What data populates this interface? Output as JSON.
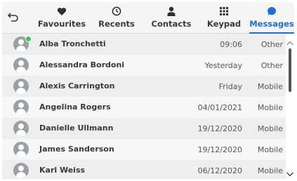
{
  "tabs": [
    {
      "label": "Favourites",
      "icon": "heart-icon"
    },
    {
      "label": "Recents",
      "icon": "clock-icon"
    },
    {
      "label": "Contacts",
      "icon": "person-icon"
    },
    {
      "label": "Keypad",
      "icon": "keypad-icon"
    },
    {
      "label": "Messages",
      "icon": "message-bubble-icon"
    }
  ],
  "active_tab": "Messages",
  "colors": {
    "accent": "#1e6fd1",
    "online": "#3cc05a"
  },
  "conversations": [
    {
      "name": "Alba Tronchetti",
      "date": "09:06",
      "type": "Other",
      "online": true
    },
    {
      "name": "Alessandra Bordoni",
      "date": "Yesterday",
      "type": "Other",
      "online": false
    },
    {
      "name": "Alexis Carrington",
      "date": "Friday",
      "type": "Mobile",
      "online": false
    },
    {
      "name": "Angelina Rogers",
      "date": "04/01/2021",
      "type": "Mobile",
      "online": false
    },
    {
      "name": "Danielle Ullmann",
      "date": "19/12/2020",
      "type": "Mobile",
      "online": false
    },
    {
      "name": "James Sanderson",
      "date": "19/12/2020",
      "type": "Mobile",
      "online": false
    },
    {
      "name": "Karl Weiss",
      "date": "06/12/2020",
      "type": "Mobile",
      "online": false
    }
  ]
}
